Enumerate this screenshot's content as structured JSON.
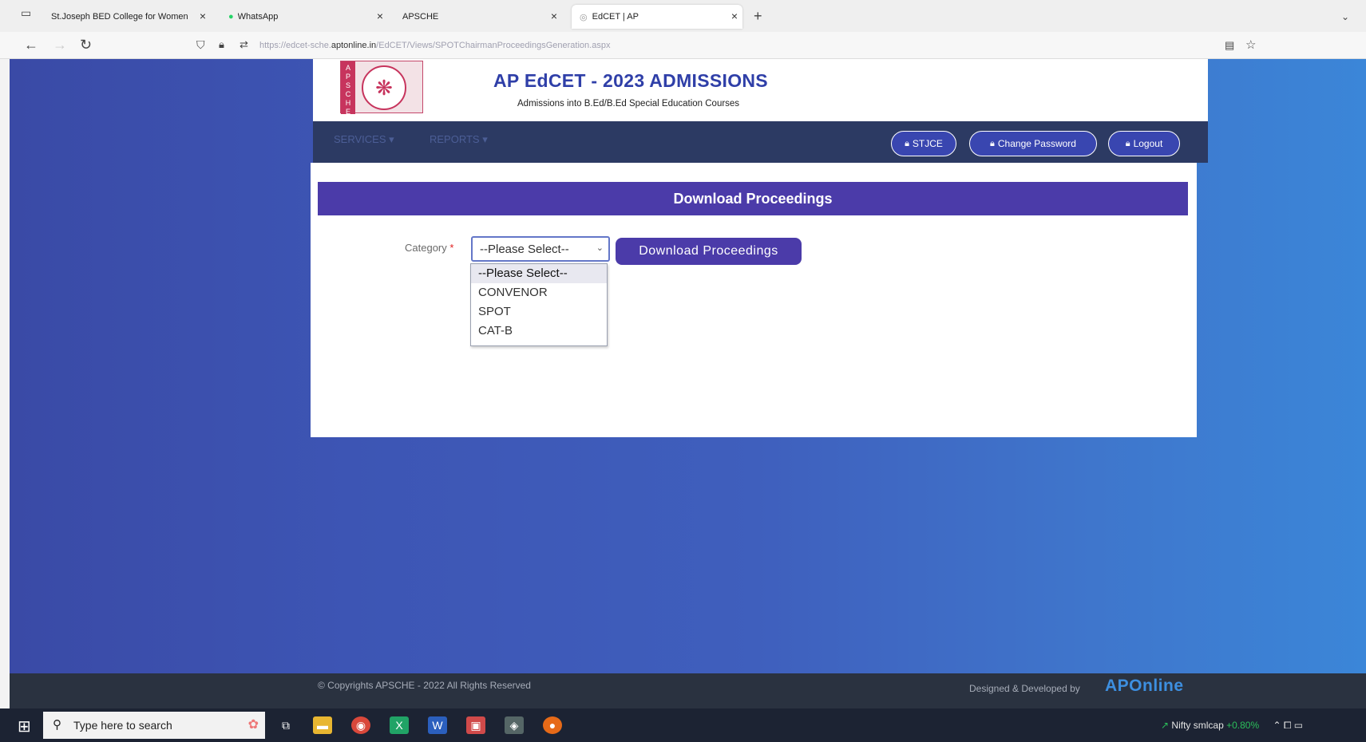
{
  "browser": {
    "tabs": [
      {
        "title": "St.Joseph BED College for Women",
        "active": false
      },
      {
        "title": "WhatsApp",
        "active": false
      },
      {
        "title": "APSCHE",
        "active": false
      },
      {
        "title": "EdCET | AP",
        "active": true
      }
    ],
    "url_prefix": "https://edcet-sche.",
    "url_domain": "aptonline.in",
    "url_path": "/EdCET/Views/SPOTChairmanProceedingsGeneration.aspx"
  },
  "header": {
    "logo_letters": "APSCHE",
    "title": "AP EdCET - 2023 ADMISSIONS",
    "subtitle": "Admissions into B.Ed/B.Ed Special Education Courses"
  },
  "nav": {
    "services": "SERVICES ▾",
    "reports": "REPORTS ▾",
    "user_button": "STJCE",
    "change_password": "Change Password",
    "logout": "Logout"
  },
  "panel": {
    "heading": "Download Proceedings",
    "category_label": "Category",
    "required_mark": "*",
    "select_value": "--Please Select--",
    "options": [
      "--Please Select--",
      "CONVENOR",
      "SPOT",
      "CAT-B"
    ],
    "download_button": "Download Proceedings"
  },
  "footer": {
    "copyright": "© Copyrights APSCHE - 2022 All Rights Reserved",
    "designed_by": "Designed & Developed by",
    "brand": "APOnline"
  },
  "taskbar": {
    "search_placeholder": "Type here to search",
    "ticker_name": "Nifty smlcap",
    "ticker_change": "+0.80%"
  }
}
